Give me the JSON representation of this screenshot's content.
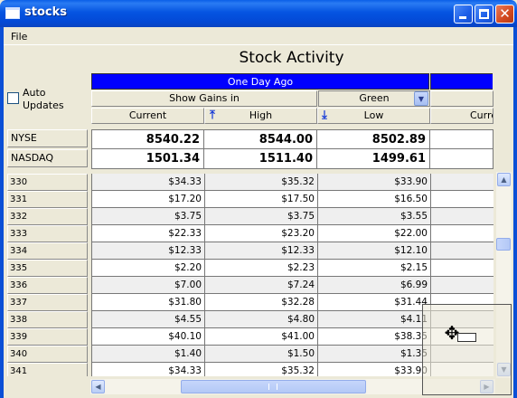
{
  "window": {
    "title": "stocks"
  },
  "menu": {
    "file": "File"
  },
  "page": {
    "title": "Stock Activity"
  },
  "auto_updates": {
    "label": "Auto Updates",
    "checked": false
  },
  "header": {
    "period": "One Day Ago",
    "show_gains_label": "Show Gains in",
    "gains_color": "Green",
    "columns": [
      "Current",
      "High",
      "Low",
      "Curre"
    ]
  },
  "indices": [
    {
      "name": "NYSE",
      "current": "8540.22",
      "high": "8544.00",
      "low": "8502.89"
    },
    {
      "name": "NASDAQ",
      "current": "1501.34",
      "high": "1511.40",
      "low": "1499.61"
    }
  ],
  "rows": [
    {
      "id": "330",
      "current": "$34.33",
      "high": "$35.32",
      "low": "$33.90"
    },
    {
      "id": "331",
      "current": "$17.20",
      "high": "$17.50",
      "low": "$16.50"
    },
    {
      "id": "332",
      "current": "$3.75",
      "high": "$3.75",
      "low": "$3.55"
    },
    {
      "id": "333",
      "current": "$22.33",
      "high": "$23.20",
      "low": "$22.00"
    },
    {
      "id": "334",
      "current": "$12.33",
      "high": "$12.33",
      "low": "$12.10"
    },
    {
      "id": "335",
      "current": "$2.20",
      "high": "$2.23",
      "low": "$2.15"
    },
    {
      "id": "336",
      "current": "$7.00",
      "high": "$7.24",
      "low": "$6.99"
    },
    {
      "id": "337",
      "current": "$31.80",
      "high": "$32.28",
      "low": "$31.44"
    },
    {
      "id": "338",
      "current": "$4.55",
      "high": "$4.80",
      "low": "$4.11"
    },
    {
      "id": "339",
      "current": "$40.10",
      "high": "$41.00",
      "low": "$38.35"
    },
    {
      "id": "340",
      "current": "$1.40",
      "high": "$1.50",
      "low": "$1.35"
    },
    {
      "id": "341",
      "current": "$34.33",
      "high": "$35.32",
      "low": "$33.90"
    }
  ],
  "colors": {
    "header_blue": "#0000ff",
    "titlebar_blue": "#0554e1",
    "alt_row": "#efefef"
  }
}
